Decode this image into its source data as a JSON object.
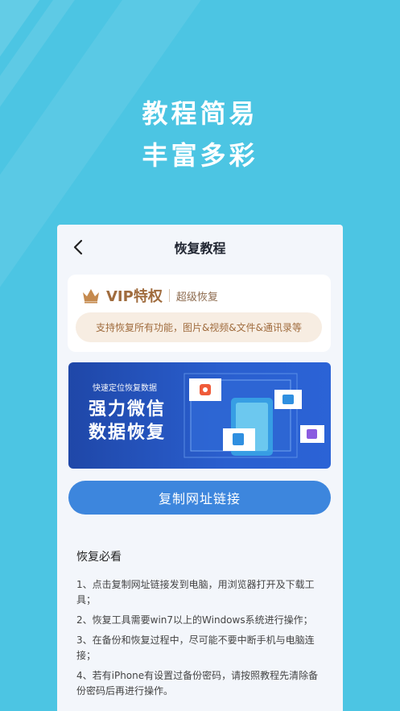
{
  "promo": {
    "line1": "教程简易",
    "line2": "丰富多彩"
  },
  "nav": {
    "title": "恢复教程"
  },
  "vip": {
    "title": "VIP特权",
    "subtitle": "超级恢复",
    "description": "支持恢复所有功能，图片&视频&文件&通讯录等"
  },
  "banner": {
    "small_text": "快速定位恢复数据",
    "line1": "强力微信",
    "line2": "数据恢复"
  },
  "cta": {
    "label": "复制网址链接"
  },
  "notes": {
    "title": "恢复必看",
    "items": [
      "1、点击复制网址链接发到电脑，用浏览器打开及下载工具；",
      "2、恢复工具需要win7以上的Windows系统进行操作；",
      "3、在备份和恢复过程中，尽可能不要中断手机与电脑连接；",
      "4、若有iPhone有设置过备份密码，请按照教程先清除备份密码后再进行操作。"
    ]
  },
  "colors": {
    "background": "#4cc5e3",
    "vip_gold": "#a06c3e",
    "cta_blue": "#3d86dd",
    "banner_blue": "#2a5fcf"
  },
  "icons": [
    "back-arrow-icon",
    "crown-icon",
    "image-icon",
    "folder-icon",
    "contacts-icon",
    "document-icon"
  ]
}
